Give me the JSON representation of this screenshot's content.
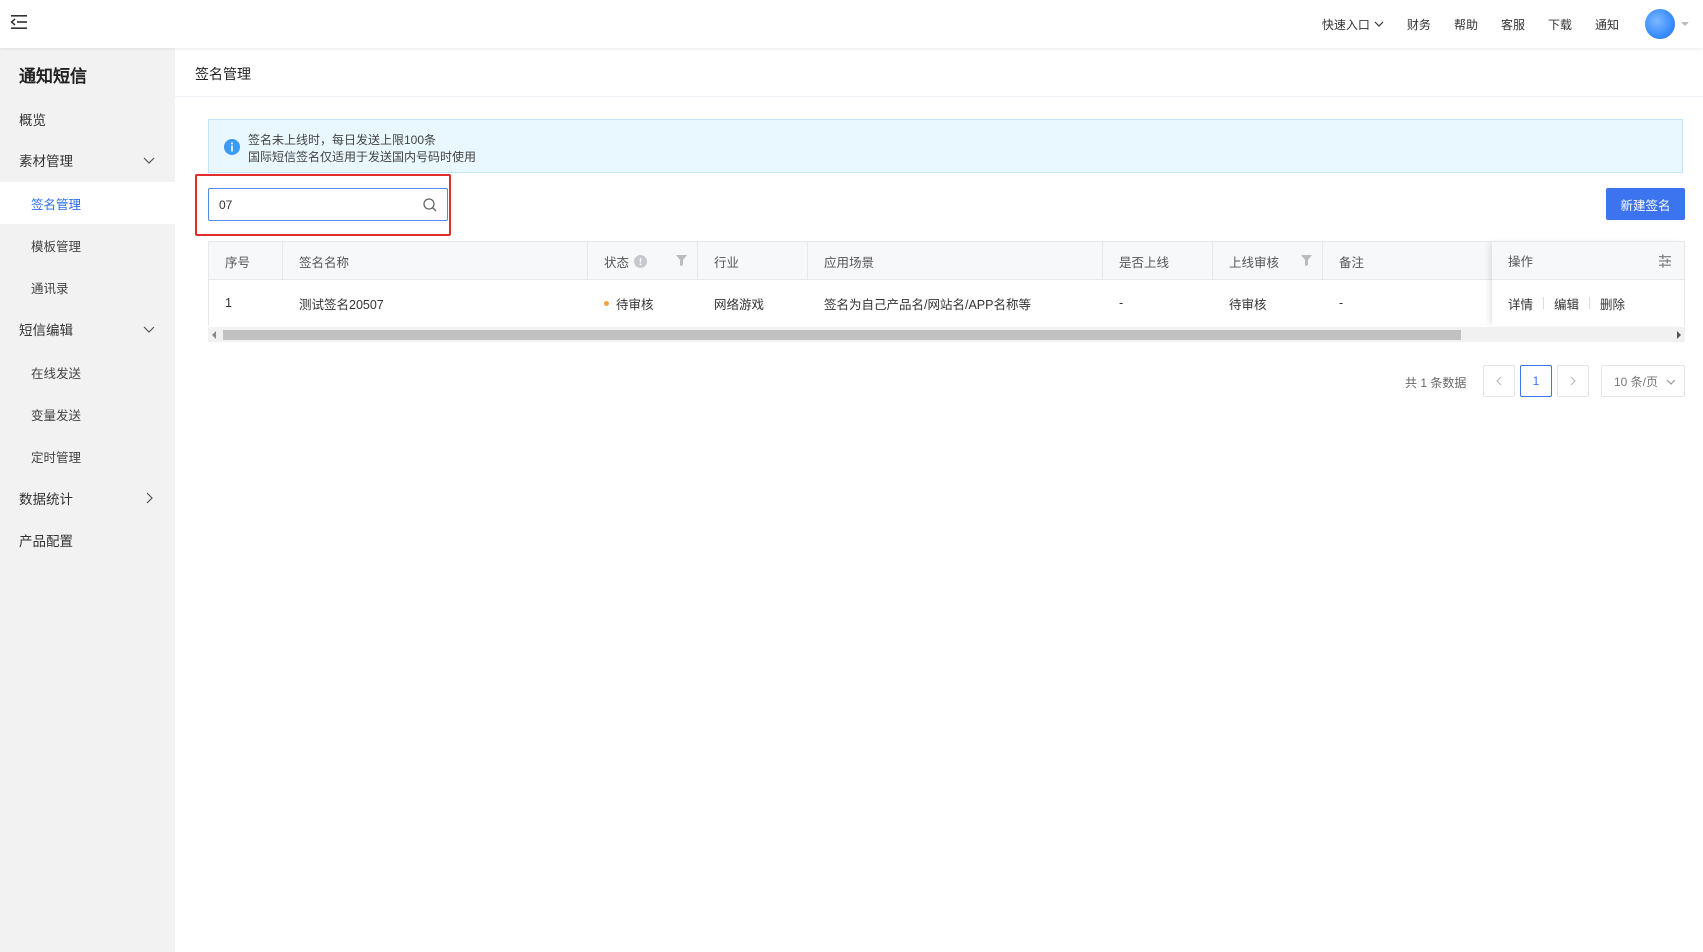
{
  "topbar": {
    "quick_entry": "快速入口",
    "nav": [
      "财务",
      "帮助",
      "客服",
      "下载",
      "通知"
    ]
  },
  "sidebar": {
    "title": "通知短信",
    "items": [
      {
        "label": "概览"
      },
      {
        "label": "素材管理",
        "expanded": true
      },
      {
        "label": "签名管理",
        "active": true
      },
      {
        "label": "模板管理"
      },
      {
        "label": "通讯录"
      },
      {
        "label": "短信编辑",
        "expanded": true
      },
      {
        "label": "在线发送"
      },
      {
        "label": "变量发送"
      },
      {
        "label": "定时管理"
      },
      {
        "label": "数据统计",
        "expanded": false
      },
      {
        "label": "产品配置"
      }
    ]
  },
  "page": {
    "title": "签名管理",
    "alert": {
      "line1": "签名未上线时，每日发送上限100条",
      "line2": "国际短信签名仅适用于发送国内号码时使用"
    },
    "search": {
      "value": "07",
      "placeholder": ""
    },
    "new_button": "新建签名"
  },
  "table": {
    "columns": [
      "序号",
      "签名名称",
      "状态",
      "行业",
      "应用场景",
      "是否上线",
      "上线审核",
      "备注",
      "操作"
    ],
    "rows": [
      {
        "index": "1",
        "name": "测试签名20507",
        "status": "待审核",
        "industry": "网络游戏",
        "scenario": "签名为自己产品名/网站名/APP名称等",
        "online": "-",
        "online_review": "待审核",
        "remark": "-",
        "actions": [
          "详情",
          "编辑",
          "删除"
        ]
      }
    ]
  },
  "pagination": {
    "total_text": "共 1 条数据",
    "current_page": "1",
    "page_size": "10 条/页"
  },
  "colors": {
    "accent": "#3c73ef",
    "highlight_border": "#e12d2d",
    "pending_dot": "#f5a23b"
  }
}
